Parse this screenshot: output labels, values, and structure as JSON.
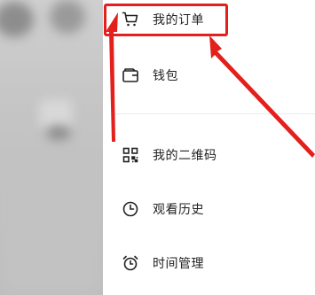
{
  "menu": {
    "items": [
      {
        "label": "我的订单",
        "icon": "cart-icon"
      },
      {
        "label": "钱包",
        "icon": "wallet-icon"
      },
      {
        "label": "我的二维码",
        "icon": "qr-code-icon"
      },
      {
        "label": "观看历史",
        "icon": "clock-icon"
      },
      {
        "label": "时间管理",
        "icon": "alarm-clock-icon"
      }
    ]
  },
  "annotation": {
    "color": "#e3201b",
    "target": "我的订单"
  }
}
